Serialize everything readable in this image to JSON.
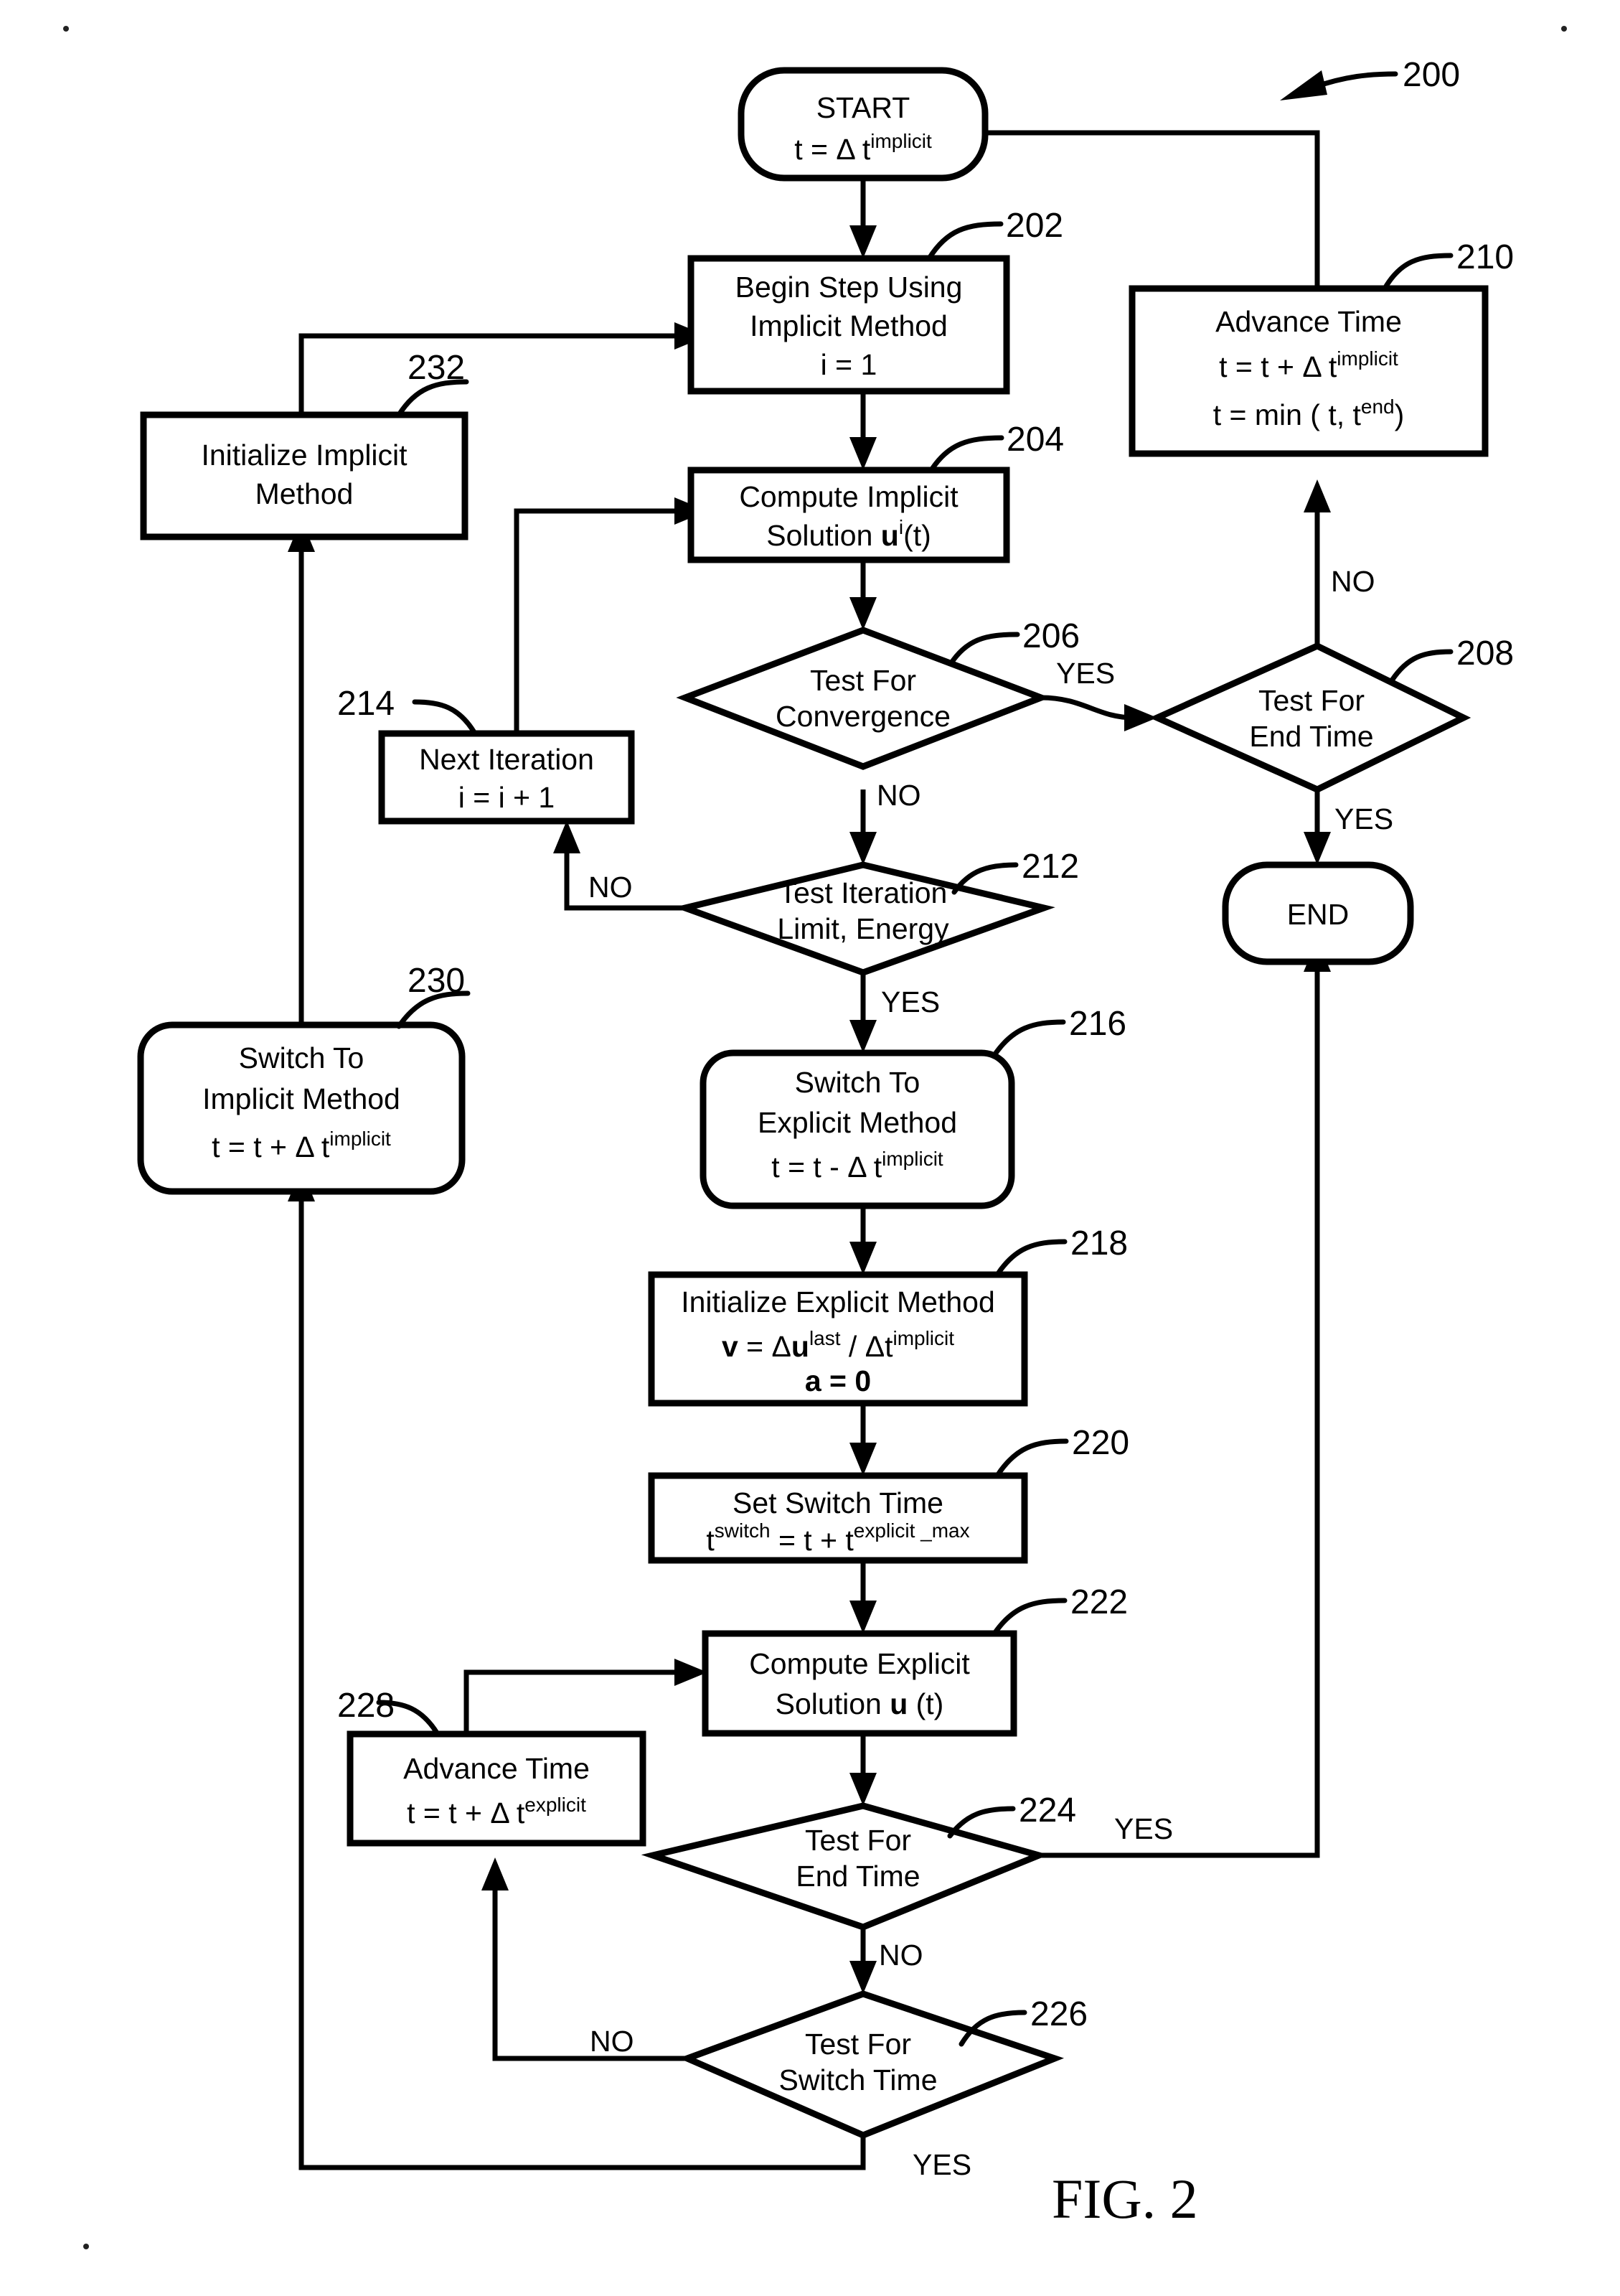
{
  "figure": {
    "caption": "FIG. 2",
    "overall_ref": "200"
  },
  "nodes": {
    "start": {
      "ref": null,
      "shape": "terminator",
      "line1": "START",
      "line2_base": "t = ",
      "line2_delta": "Δ",
      "line2_t": " t",
      "line2_sup": "implicit"
    },
    "begin_step": {
      "ref": "202",
      "shape": "process",
      "line1": "Begin Step Using",
      "line2": "Implicit Method",
      "line3": "i = 1"
    },
    "compute_implicit": {
      "ref": "204",
      "shape": "process",
      "line1": "Compute Implicit",
      "line2_pre": "Solution ",
      "line2_u": "u",
      "line2_sup": "i",
      "line2_post": "(t)"
    },
    "test_convergence": {
      "ref": "206",
      "shape": "decision",
      "line1": "Test For",
      "line2": "Convergence"
    },
    "test_end_time_implicit": {
      "ref": "208",
      "shape": "decision",
      "line1": "Test For",
      "line2": "End Time"
    },
    "advance_time_implicit": {
      "ref": "210",
      "shape": "process",
      "line1": "Advance Time",
      "line2_pre": "t = t + ",
      "line2_delta": "Δ",
      "line2_t": " t",
      "line2_sup": "implicit",
      "line3_pre": "t = min ( t, t",
      "line3_sup": "end",
      "line3_post": ")"
    },
    "end": {
      "ref": null,
      "shape": "terminator",
      "line1": "END"
    },
    "test_iteration_limit": {
      "ref": "212",
      "shape": "decision",
      "line1": "Test Iteration",
      "line2": "Limit, Energy"
    },
    "next_iteration": {
      "ref": "214",
      "shape": "process",
      "line1": "Next Iteration",
      "line2": "i = i + 1"
    },
    "switch_to_explicit": {
      "ref": "216",
      "shape": "terminator",
      "line1": "Switch To",
      "line2": "Explicit Method",
      "line3_pre": "t = t - ",
      "line3_delta": "Δ",
      "line3_t": " t",
      "line3_sup": "implicit"
    },
    "initialize_explicit": {
      "ref": "218",
      "shape": "process",
      "line1": "Initialize Explicit Method",
      "line2_v": "v",
      "line2_eq": " = ",
      "line2_delta1": "Δ",
      "line2_u": "u",
      "line2_sup1": "last",
      "line2_div": " / ",
      "line2_delta2": "Δ",
      "line2_t": "t",
      "line2_sup2": "implicit",
      "line3_a": "a",
      "line3_rest": " = 0"
    },
    "set_switch_time": {
      "ref": "220",
      "shape": "process",
      "line1": "Set Switch Time",
      "line2_t": "t",
      "line2_sup1": "switch",
      "line2_mid": " = t + t",
      "line2_sup2": "explicit _max"
    },
    "compute_explicit": {
      "ref": "222",
      "shape": "process",
      "line1": "Compute Explicit",
      "line2_pre": "Solution ",
      "line2_u": "u",
      "line2_post": " (t)"
    },
    "test_end_time_explicit": {
      "ref": "224",
      "shape": "decision",
      "line1": "Test For",
      "line2": "End Time"
    },
    "test_switch_time": {
      "ref": "226",
      "shape": "decision",
      "line1": "Test For",
      "line2": "Switch Time"
    },
    "advance_time_explicit": {
      "ref": "228",
      "shape": "process",
      "line1": "Advance Time",
      "line2_pre": "t = t + ",
      "line2_delta": "Δ",
      "line2_t": " t",
      "line2_sup": "explicit"
    },
    "switch_to_implicit": {
      "ref": "230",
      "shape": "terminator",
      "line1": "Switch To",
      "line2": "Implicit Method",
      "line3_pre": "t = t + ",
      "line3_delta": "Δ",
      "line3_t": " t",
      "line3_sup": "implicit"
    },
    "initialize_implicit": {
      "ref": "232",
      "shape": "process",
      "line1": "Initialize Implicit",
      "line2": "Method"
    }
  },
  "edge_labels": {
    "convergence_yes": "YES",
    "convergence_no": "NO",
    "end_time_implicit_no": "NO",
    "end_time_implicit_yes": "YES",
    "iteration_limit_no": "NO",
    "iteration_limit_yes": "YES",
    "end_time_explicit_yes": "YES",
    "end_time_explicit_no": "NO",
    "switch_time_no": "NO",
    "switch_time_yes": "YES"
  },
  "colors": {
    "ink": "#000000",
    "paper": "#ffffff"
  }
}
